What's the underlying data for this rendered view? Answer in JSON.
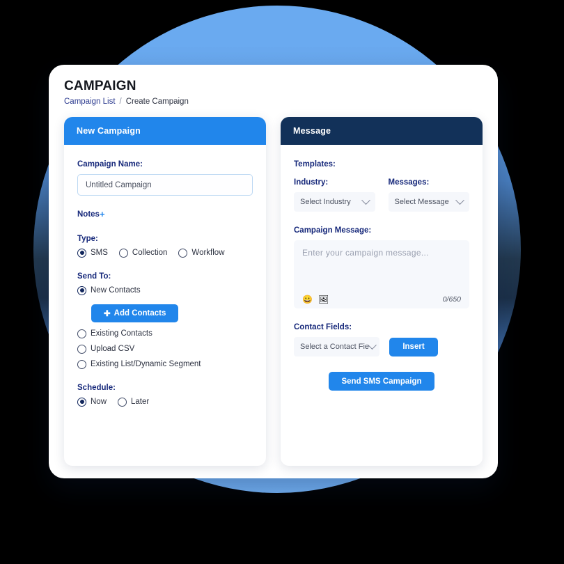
{
  "header": {
    "title": "CAMPAIGN",
    "breadcrumb": {
      "link": "Campaign List",
      "separator": "/",
      "current": "Create Campaign"
    }
  },
  "left_panel": {
    "header": "New Campaign",
    "campaign_name": {
      "label": "Campaign Name:",
      "value": "Untitled Campaign"
    },
    "notes": {
      "label": "Notes",
      "plus": "+"
    },
    "type": {
      "label": "Type:",
      "options": [
        {
          "label": "SMS",
          "checked": true
        },
        {
          "label": "Collection",
          "checked": false
        },
        {
          "label": "Workflow",
          "checked": false
        }
      ]
    },
    "send_to": {
      "label": "Send To:",
      "options": [
        {
          "label": "New Contacts",
          "checked": true
        },
        {
          "label": "Existing Contacts",
          "checked": false
        },
        {
          "label": "Upload CSV",
          "checked": false
        },
        {
          "label": "Existing List/Dynamic Segment",
          "checked": false
        }
      ],
      "add_contacts_button": "Add Contacts",
      "add_contacts_icon": "plus-icon"
    },
    "schedule": {
      "label": "Schedule:",
      "options": [
        {
          "label": "Now",
          "checked": true
        },
        {
          "label": "Later",
          "checked": false
        }
      ]
    }
  },
  "right_panel": {
    "header": "Message",
    "templates": {
      "label": "Templates:",
      "industry": {
        "label": "Industry:",
        "selected": "Select Industry"
      },
      "messages": {
        "label": "Messages:",
        "selected": "Select Message"
      }
    },
    "campaign_message": {
      "label": "Campaign Message:",
      "placeholder": "Enter your campaign message...",
      "emoji_icon": "😀",
      "image_icon": "🖼",
      "counter": "0/650"
    },
    "contact_fields": {
      "label": "Contact Fields:",
      "selected": "Select a Contact Fie",
      "insert_button": "Insert"
    },
    "send_button": "Send SMS Campaign"
  },
  "colors": {
    "accent_blue": "#2186eb",
    "navy": "#123159",
    "label_navy": "#16287a"
  }
}
